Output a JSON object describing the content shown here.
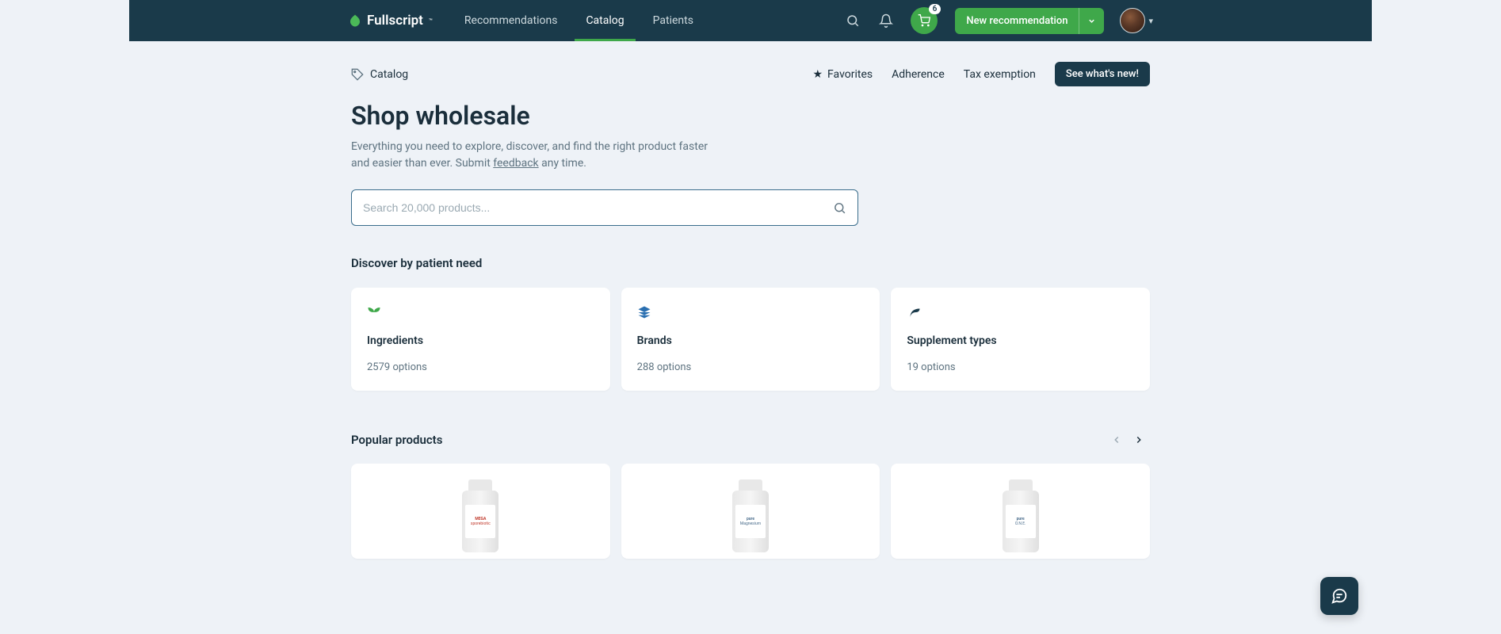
{
  "header": {
    "logo_text": "Fullscript",
    "nav": [
      {
        "label": "Recommendations",
        "active": false
      },
      {
        "label": "Catalog",
        "active": true
      },
      {
        "label": "Patients",
        "active": false
      }
    ],
    "cart_count": "6",
    "new_rec_label": "New recommendation"
  },
  "subheader": {
    "breadcrumb": "Catalog",
    "favorites": "Favorites",
    "adherence": "Adherence",
    "tax_exemption": "Tax exemption",
    "cta": "See what's new!"
  },
  "page": {
    "title": "Shop wholesale",
    "desc_pre": "Everything you need to explore, discover, and find the right product faster and easier than ever. Submit ",
    "desc_link": "feedback",
    "desc_post": " any time."
  },
  "search": {
    "placeholder": "Search 20,000 products..."
  },
  "discover": {
    "heading": "Discover by patient need",
    "cards": [
      {
        "title": "Ingredients",
        "sub": "2579 options",
        "icon": "seedling"
      },
      {
        "title": "Brands",
        "sub": "288 options",
        "icon": "layers"
      },
      {
        "title": "Supplement types",
        "sub": "19 options",
        "icon": "leaf"
      }
    ]
  },
  "popular": {
    "heading": "Popular products",
    "products": [
      {
        "brand": "MEGA",
        "subtext": "sporebiotic",
        "color": "red"
      },
      {
        "brand": "pure",
        "subtext": "Magnesium",
        "color": "blue"
      },
      {
        "brand": "pure",
        "subtext": "O.N.E.",
        "color": "blue"
      }
    ]
  }
}
